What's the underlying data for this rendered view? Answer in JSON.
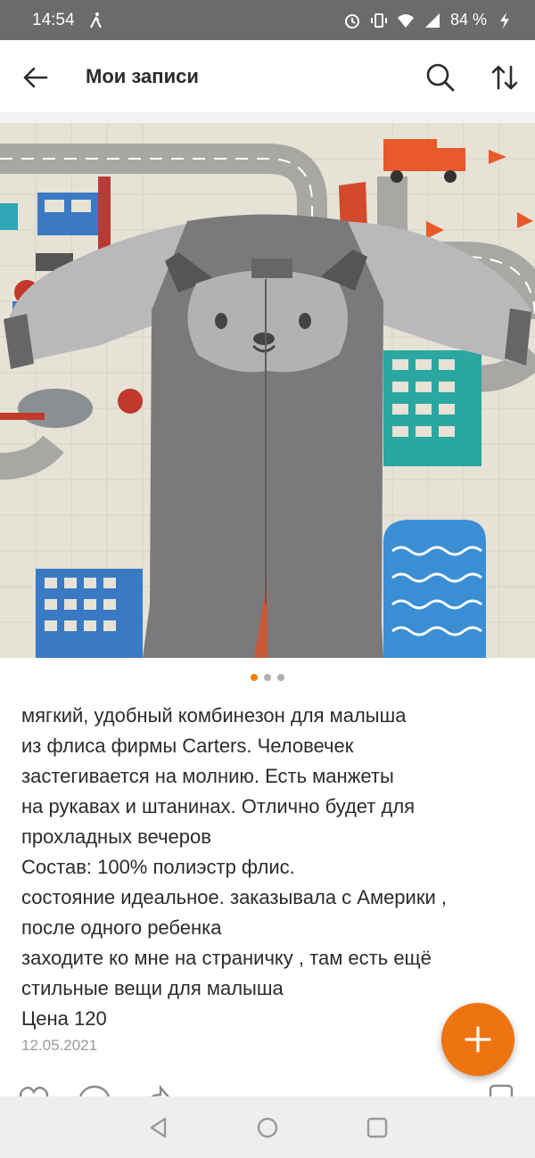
{
  "status_bar": {
    "time": "14:54",
    "battery": "84 %",
    "icons": [
      "walking-icon",
      "alarm-icon",
      "vibrate-icon",
      "wifi-icon",
      "signal-icon",
      "charging-icon"
    ]
  },
  "header": {
    "title": "Мои записи",
    "icons": [
      "back-arrow-icon",
      "search-icon",
      "sort-icon"
    ]
  },
  "photo": {
    "description": "baby fleece jumpsuit photo",
    "slide_count": 3,
    "active_slide": 1
  },
  "post": {
    "lines": [
      "мягкий, удобный комбинезон для малыша",
      "из флиса фирмы Carters. Человечек",
      "застегивается на молнию. Есть манжеты",
      "на рукавах и штанинах. Отлично будет для",
      "прохладных вечеров",
      "Состав: 100% полиэстр флис.",
      "состояние идеальное. заказывала с Америки ,",
      "после одного ребенка",
      "заходите ко мне на страничку , там есть ещё",
      "стильные вещи для малыша",
      "Цена 120"
    ],
    "date": "12.05.2021"
  },
  "colors": {
    "accent": "#ee7412",
    "status_bar": "#6b6b6b",
    "text": "#2b2b2b",
    "muted": "#9a9a9a"
  }
}
